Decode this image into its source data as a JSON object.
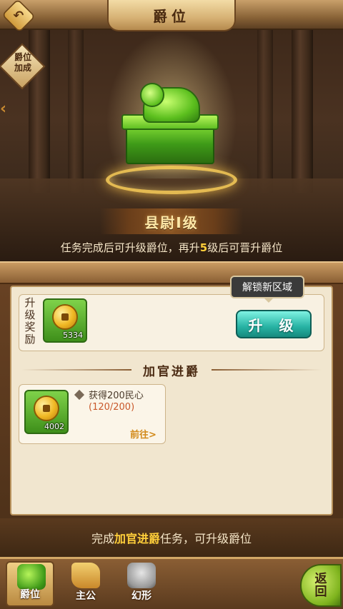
{
  "header": {
    "title": "爵位",
    "back_icon": "back-arrow-icon"
  },
  "side": {
    "bonus_label": "爵位\n加成",
    "bonus_line1": "爵位",
    "bonus_line2": "加成"
  },
  "rank": {
    "name": "县尉I级"
  },
  "hint": {
    "prefix": "任务完成后可升级爵位，再升",
    "number": "5",
    "suffix": "级后可晋升爵位"
  },
  "reward": {
    "label": "升级奖励",
    "item_count": "5334",
    "tooltip": "解锁新区域",
    "upgrade_button": "升 级"
  },
  "section": {
    "title": "加官进爵"
  },
  "task": {
    "item_count": "4002",
    "title": "获得200民心",
    "progress": "(120/200)",
    "go_label": "前往>"
  },
  "footer_hint": {
    "prefix": "完成",
    "highlight": "加官进爵",
    "suffix": "任务，可升级爵位"
  },
  "tabs": [
    {
      "label": "爵位",
      "icon": "jade-seal-icon",
      "active": true
    },
    {
      "label": "主公",
      "icon": "scroll-icon",
      "active": false
    },
    {
      "label": "幻形",
      "icon": "dragon-statue-icon",
      "active": false
    }
  ],
  "return_button": {
    "line1": "返",
    "line2": "回"
  },
  "colors": {
    "accent": "#27b3a4",
    "highlight": "#ffcf3a",
    "progress": "#c9582a"
  }
}
